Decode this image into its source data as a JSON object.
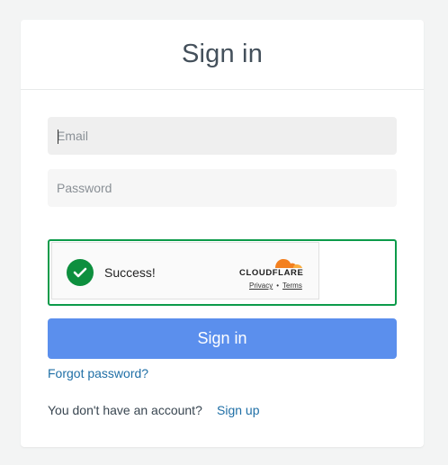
{
  "header": {
    "title": "Sign in"
  },
  "form": {
    "email_placeholder": "Email",
    "email_value": "",
    "password_placeholder": "Password",
    "password_value": ""
  },
  "captcha": {
    "status_text": "Success!",
    "provider": "CLOUDFLARE",
    "privacy_label": "Privacy",
    "separator": "•",
    "terms_label": "Terms",
    "status_color": "#0d8f3e"
  },
  "actions": {
    "signin_label": "Sign in",
    "forgot_label": "Forgot password?",
    "no_account_text": "You don't have an account?",
    "signup_label": "Sign up"
  },
  "colors": {
    "primary_button": "#5b8fed",
    "link": "#1f6fa6",
    "success_border": "#0c9b4a"
  },
  "icons": [
    "checkmark-icon",
    "cloudflare-logo-icon"
  ]
}
